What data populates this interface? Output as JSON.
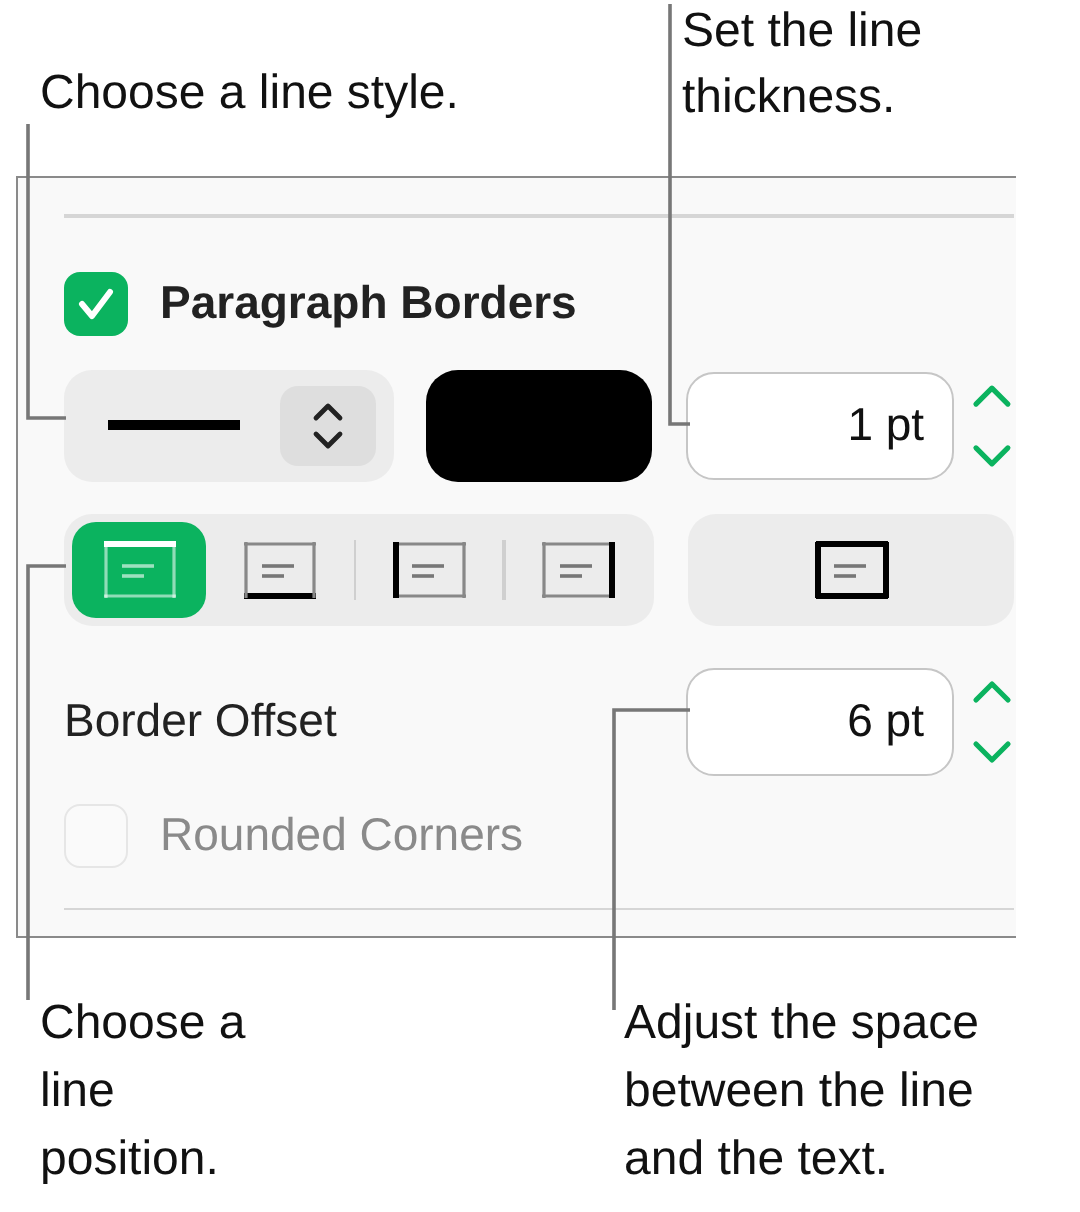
{
  "callouts_top": [
    {
      "text": "Choose a line style."
    },
    {
      "text": "Set the line thickness."
    }
  ],
  "panel": {
    "section": {
      "title": "Paragraph Borders",
      "checked": true
    },
    "thickness": {
      "value": "1 pt"
    },
    "positions": [
      {
        "kind": "top",
        "selected": true
      },
      {
        "kind": "bottom",
        "selected": false
      },
      {
        "kind": "left",
        "selected": false
      },
      {
        "kind": "right",
        "selected": false
      }
    ],
    "outline": {
      "kind": "all"
    },
    "offset": {
      "label": "Border Offset",
      "value": "6 pt"
    },
    "rounded": {
      "label": "Rounded Corners",
      "checked": false,
      "disabled": true
    }
  },
  "callouts_bottom": [
    {
      "text": "Choose a line position."
    },
    {
      "text": "Adjust the space between the line and the text."
    }
  ]
}
